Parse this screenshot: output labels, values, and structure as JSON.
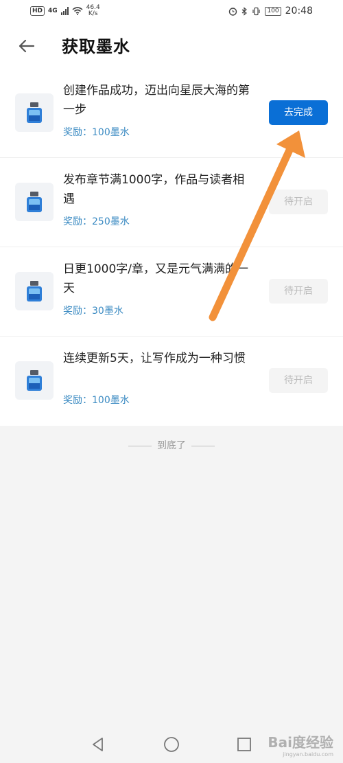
{
  "status_bar": {
    "hd": "HD",
    "network": "4G",
    "speed_value": "46.4",
    "speed_unit": "K/s",
    "battery": "100",
    "time": "20:48"
  },
  "header": {
    "title": "获取墨水"
  },
  "tasks": [
    {
      "description": "创建作品成功，迈出向星辰大海的第一步",
      "reward": "奖励：100墨水",
      "button": "去完成",
      "state": "active"
    },
    {
      "description": "发布章节满1000字，作品与读者相遇",
      "reward": "奖励：250墨水",
      "button": "待开启",
      "state": "disabled"
    },
    {
      "description": "日更1000字/章，又是元气满满的一天",
      "reward": "奖励：30墨水",
      "button": "待开启",
      "state": "disabled"
    },
    {
      "description": "连续更新5天，让写作成为一种习惯",
      "reward": "奖励：100墨水",
      "button": "待开启",
      "state": "disabled"
    }
  ],
  "footer": {
    "end_text": "到底了"
  },
  "watermark": {
    "main": "Bai度经验",
    "sub": "jingyan.baidu.com"
  },
  "colors": {
    "primary_button": "#0a6fd6",
    "reward_text": "#3a8ac2",
    "annotation_arrow": "#f2913a"
  }
}
